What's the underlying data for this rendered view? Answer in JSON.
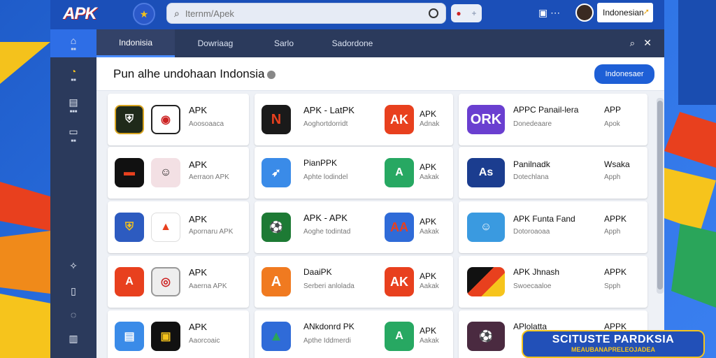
{
  "header": {
    "logo": "APK",
    "search_placeholder": "Iternm/Apek",
    "user_label": "Indonesian"
  },
  "navbar": {
    "tabs": [
      "Indonisia",
      "Dowriaag",
      "Sarlo",
      "Sadordone"
    ]
  },
  "page": {
    "title": "Pun  alhe undohaan Indonsia",
    "action_button": "Indonesaer"
  },
  "cards": [
    {
      "title": "APK",
      "sub": "Aoosoaaca",
      "title2": "",
      "sub2": ""
    },
    {
      "title": "APK - LatPK",
      "sub": "Aoghortdorridt",
      "title2": "APK",
      "sub2": "Adnak"
    },
    {
      "title": "APPC Panail-lera",
      "sub": "Donedeaare",
      "title2": "APP",
      "sub2": "Apok"
    },
    {
      "title": "APK",
      "sub": "Aerraon APK",
      "title2": "",
      "sub2": ""
    },
    {
      "title": "PianPPK",
      "sub": "Aphte lodindel",
      "title2": "APK",
      "sub2": "Aakak"
    },
    {
      "title": "Panilnadk",
      "sub": "Dotechlana",
      "title2": "Wsaka",
      "sub2": "Apph"
    },
    {
      "title": "APK",
      "sub": "Apornaru APK",
      "title2": "",
      "sub2": ""
    },
    {
      "title": "APK - APK",
      "sub": "Aoghe todintad",
      "title2": "APK",
      "sub2": "Aakak"
    },
    {
      "title": "APK Funta Fand",
      "sub": "Dotoroaoaa",
      "title2": "APPK",
      "sub2": "Apph"
    },
    {
      "title": "APK",
      "sub": "Aaerna APK",
      "title2": "",
      "sub2": ""
    },
    {
      "title": "DaaiPK",
      "sub": "Serberi anlolada",
      "title2": "APK",
      "sub2": "Aakak"
    },
    {
      "title": "APK Jhnash",
      "sub": "Swoecaaloe",
      "title2": "APPK",
      "sub2": "Spph"
    },
    {
      "title": "APK",
      "sub": "Aaorcoaic",
      "title2": "",
      "sub2": ""
    },
    {
      "title": "ANkdonrd PK",
      "sub": "Apthe Iddmerdi",
      "title2": "APK",
      "sub2": "Aakak"
    },
    {
      "title": "APlolatta",
      "sub": "",
      "title2": "APPK",
      "sub2": ""
    }
  ],
  "banner": {
    "line1": "SCITUSTE PARDKSIA",
    "line2": "MEAUBANAPRELEOJADEA"
  },
  "colors": {
    "brand": "#1b4fb8",
    "accent": "#1e5fd6",
    "sidebar": "#2b3a5c"
  }
}
